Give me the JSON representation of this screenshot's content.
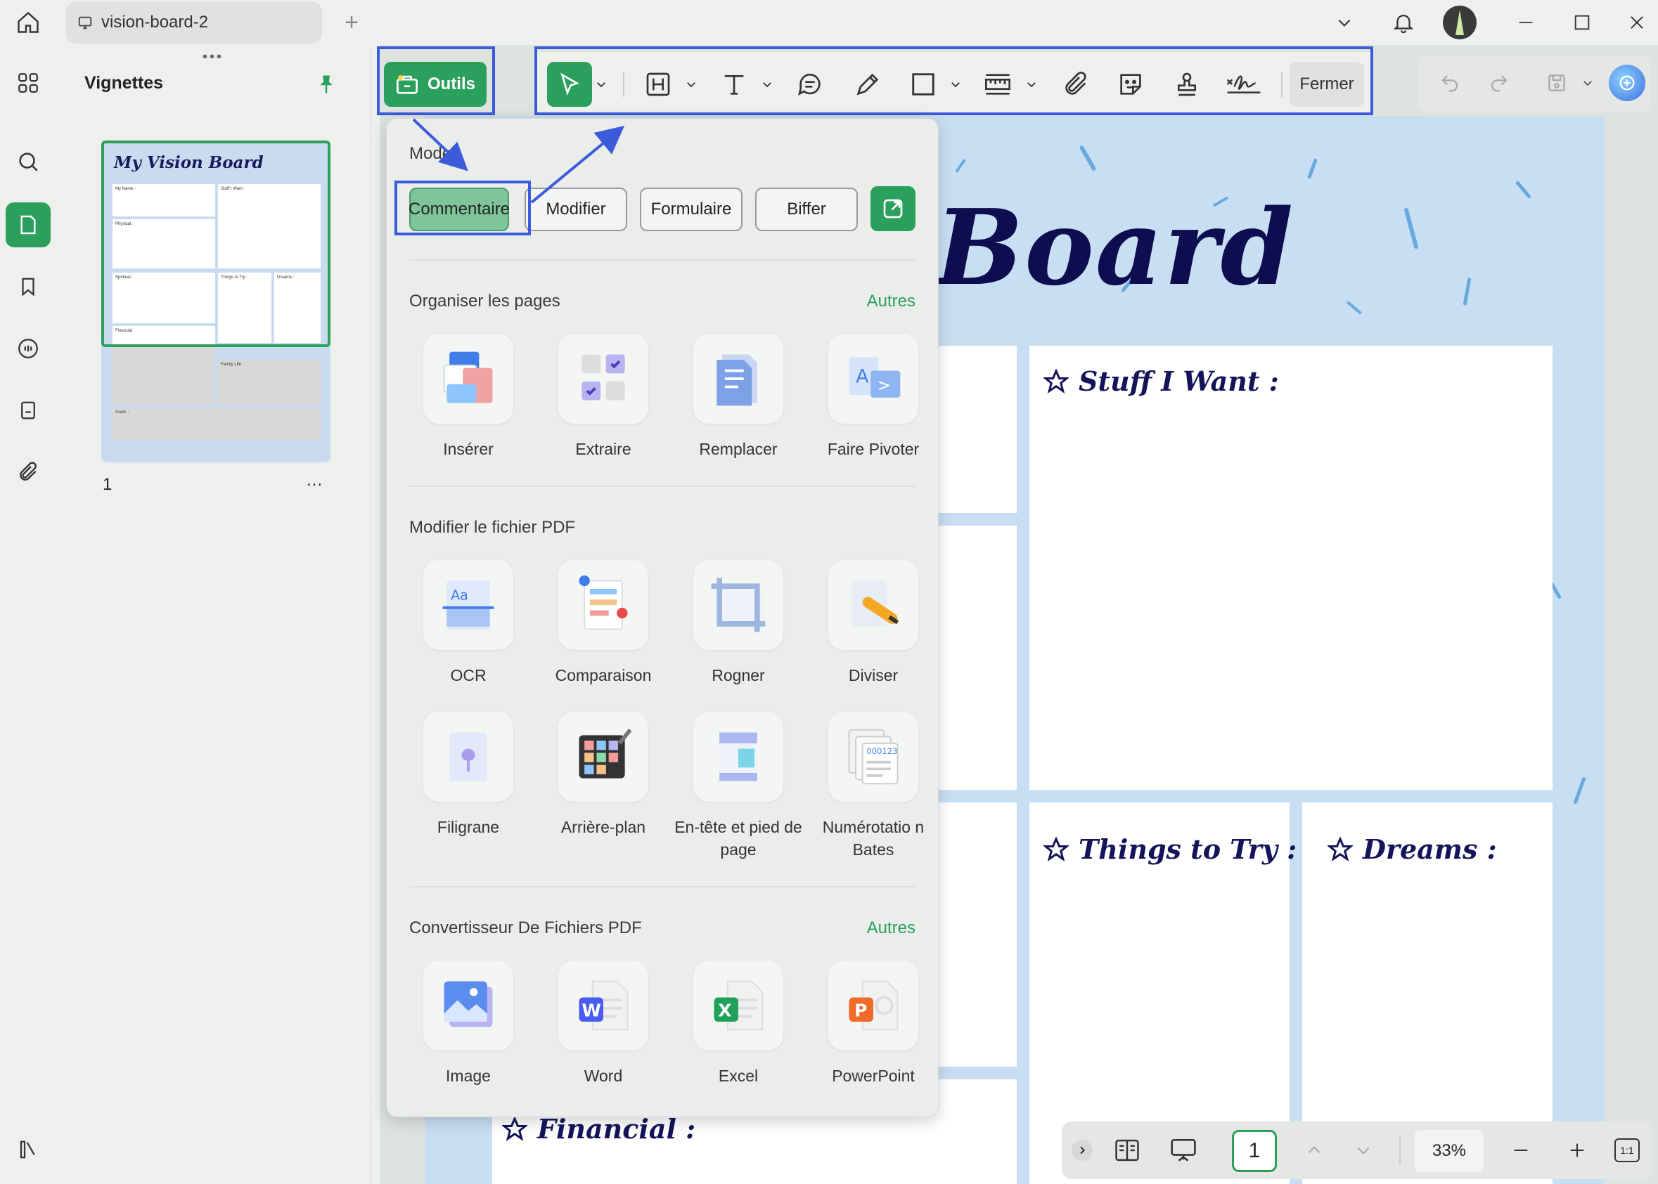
{
  "window": {
    "tab_title": "vision-board-2",
    "new_tab_symbol": "+"
  },
  "thumbnails": {
    "title": "Vignettes",
    "page_number": "1",
    "more": "...",
    "thumb_title": "My Vision Board",
    "thumb_labels": [
      "My Name :",
      "Stuff I Want :",
      "Physical :",
      "Spiritual :",
      "Things to Try :",
      "Dreams :",
      "Financial :",
      "Family Life :",
      "Goals :"
    ]
  },
  "toolbar": {
    "outils_label": "Outils",
    "fermer_label": "Fermer"
  },
  "popup": {
    "mode_title": "Mode",
    "modes": [
      "Commentaire",
      "Modifier",
      "Formulaire",
      "Biffer"
    ],
    "sections": {
      "organize": {
        "title": "Organiser les pages",
        "more": "Autres",
        "items": [
          "Insérer",
          "Extraire",
          "Remplacer",
          "Faire Pivoter"
        ]
      },
      "modify": {
        "title": "Modifier le fichier PDF",
        "items": [
          "OCR",
          "Comparaison",
          "Rogner",
          "Diviser",
          "Filigrane",
          "Arrière-plan",
          "En-tête et pied de page",
          "Numérotatio n Bates"
        ]
      },
      "convert": {
        "title": "Convertisseur De Fichiers PDF",
        "more": "Autres",
        "items": [
          "Image",
          "Word",
          "Excel",
          "PowerPoint"
        ]
      }
    }
  },
  "document": {
    "title_fragment": "Board",
    "headings": {
      "stuff": "Stuff I Want :",
      "things": "Things to Try :",
      "dreams": "Dreams :",
      "financial": "Financial :"
    }
  },
  "bottombar": {
    "page_value": "1",
    "zoom": "33%",
    "fit_label": "1:1"
  },
  "colors": {
    "accent": "#2aa05c",
    "annotation": "#3b5bdb",
    "doc_background": "#c8def3",
    "heading_ink": "#14145a"
  }
}
